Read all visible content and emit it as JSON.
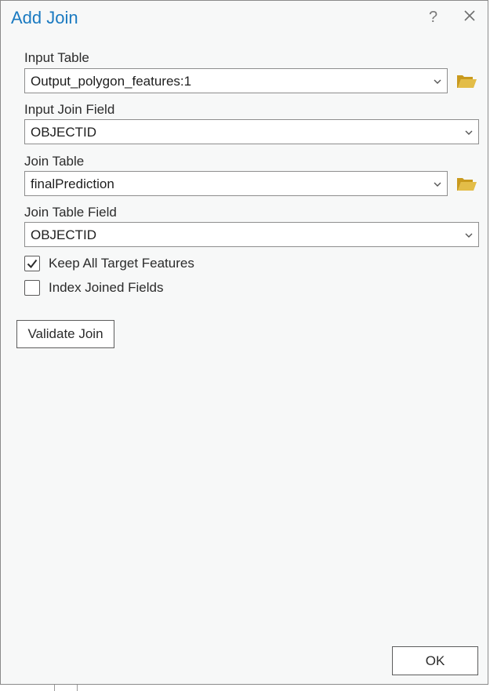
{
  "dialog": {
    "title": "Add Join",
    "help": "?"
  },
  "fields": {
    "input_table": {
      "label": "Input Table",
      "value": "Output_polygon_features:1"
    },
    "input_join_field": {
      "label": "Input Join Field",
      "value": "OBJECTID"
    },
    "join_table": {
      "label": "Join Table",
      "value": "finalPrediction"
    },
    "join_table_field": {
      "label": "Join Table Field",
      "value": "OBJECTID"
    }
  },
  "options": {
    "keep_all": {
      "label": "Keep All Target Features",
      "checked": true
    },
    "index_joined": {
      "label": "Index Joined Fields",
      "checked": false
    }
  },
  "buttons": {
    "validate": "Validate Join",
    "ok": "OK"
  },
  "colors": {
    "title": "#1a7ac1",
    "folder": "#d8b13a",
    "background": "#f7f8f8"
  },
  "icons": [
    "help-icon",
    "close-icon",
    "chevron-down-icon",
    "folder-icon",
    "checkmark-icon"
  ]
}
